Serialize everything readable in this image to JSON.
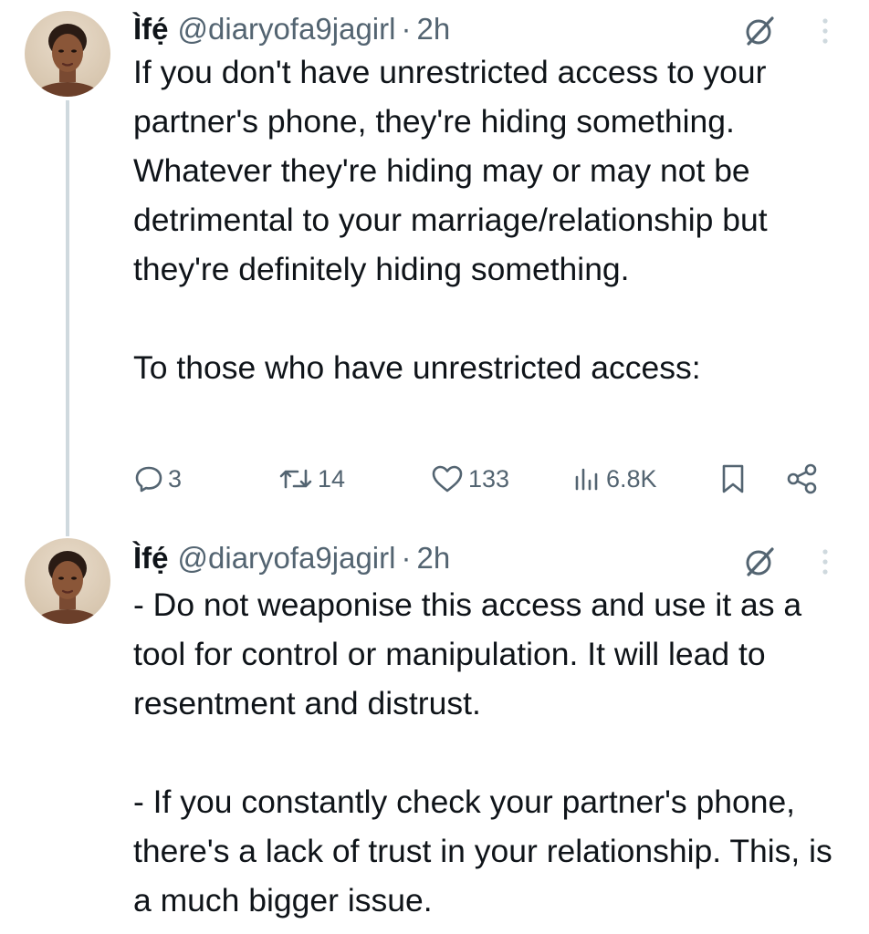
{
  "tweets": [
    {
      "author_name": "Ìfẹ́",
      "handle": "@diaryofa9jagirl",
      "separator": "·",
      "time": "2h",
      "text": "If you don't have unrestricted access to your partner's phone, they're hiding something. Whatever they're hiding may or may not be detrimental to your marriage/relationship but they're definitely hiding something.\n\nTo those who have unrestricted access:",
      "stats": {
        "replies": "3",
        "reposts": "14",
        "likes": "133",
        "views": "6.8K"
      },
      "icons": [
        "reply-icon",
        "repost-icon",
        "like-icon",
        "views-icon",
        "bookmark-icon",
        "share-icon",
        "grok-icon",
        "more-icon"
      ]
    },
    {
      "author_name": "Ìfẹ́",
      "handle": "@diaryofa9jagirl",
      "separator": "·",
      "time": "2h",
      "text": "- Do not weaponise this access and use it as a tool for control or manipulation. It will lead to resentment and distrust.\n\n- If you constantly check your partner's phone, there's a lack of trust in your relationship. This, is a much bigger issue.",
      "icons": [
        "grok-icon",
        "more-icon"
      ]
    }
  ],
  "colors": {
    "text_primary": "#0f1419",
    "text_secondary": "#536471",
    "thread_line": "#cfd9de",
    "background": "#ffffff"
  }
}
